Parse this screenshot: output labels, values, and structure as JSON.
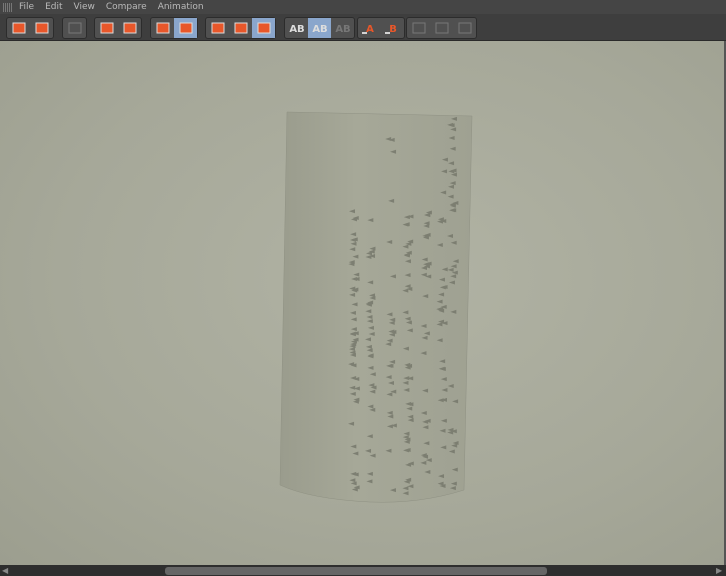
{
  "menubar": {
    "items": [
      "File",
      "Edit",
      "View",
      "Compare",
      "Animation"
    ]
  },
  "toolbar": {
    "accent": "#e8572a",
    "active": "#8aa6cc",
    "groups": [
      {
        "buttons": [
          {
            "icon": "open-folder-icon"
          },
          {
            "icon": "save-as-icon"
          }
        ]
      },
      {
        "buttons": [
          {
            "icon": "grid-icon",
            "disabled": true
          }
        ]
      },
      {
        "buttons": [
          {
            "icon": "import-icon"
          },
          {
            "icon": "export-object-icon"
          }
        ]
      },
      {
        "buttons": [
          {
            "icon": "delete-icon"
          },
          {
            "icon": "properties-icon",
            "active": true
          }
        ]
      },
      {
        "buttons": [
          {
            "icon": "view-a-icon"
          },
          {
            "icon": "view-b-icon"
          },
          {
            "icon": "view-overlay-icon",
            "active": true
          }
        ]
      },
      {
        "buttons": [
          {
            "icon": "side-by-side-ab-icon",
            "label": "AB"
          },
          {
            "icon": "split-ab-icon",
            "label": "AB",
            "active": true
          },
          {
            "icon": "overlay-ab-icon",
            "label": "AB",
            "disabled": true
          }
        ]
      },
      {
        "buttons": [
          {
            "icon": "set-a-icon",
            "label": "A"
          },
          {
            "icon": "set-b-icon",
            "label": "B"
          }
        ]
      },
      {
        "buttons": [
          {
            "icon": "layout-1-icon",
            "disabled": true
          },
          {
            "icon": "layout-2-icon",
            "disabled": true
          },
          {
            "icon": "layout-3-icon",
            "disabled": true
          }
        ]
      }
    ]
  },
  "scrollbar": {
    "position": 0.22,
    "size": 0.54
  }
}
